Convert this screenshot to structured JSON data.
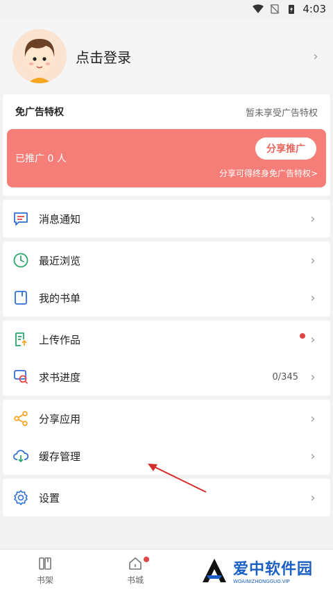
{
  "status_bar": {
    "time": "4:03"
  },
  "profile": {
    "login_text": "点击登录"
  },
  "ad_privilege": {
    "title": "免广告特权",
    "status": "暂未享受广告特权",
    "promoted_count": "已推广 0 人",
    "share_button": "分享推广",
    "hint": "分享可得终身免广告特权>"
  },
  "menu": {
    "messages": "消息通知",
    "recent": "最近浏览",
    "booklist": "我的书单",
    "upload": "上传作品",
    "request_progress": "求书进度",
    "request_value": "0/345",
    "share_app": "分享应用",
    "cache": "缓存管理",
    "settings": "设置"
  },
  "tabbar": {
    "bookshelf": "书架",
    "bookstore": "书城"
  },
  "watermark": {
    "main": "爱中软件园",
    "sub": "WOAINIZHONGGUO.VIP"
  },
  "colors": {
    "promo": "#f57f78",
    "accent_blue": "#1a5fc4",
    "badge": "#e04848"
  }
}
